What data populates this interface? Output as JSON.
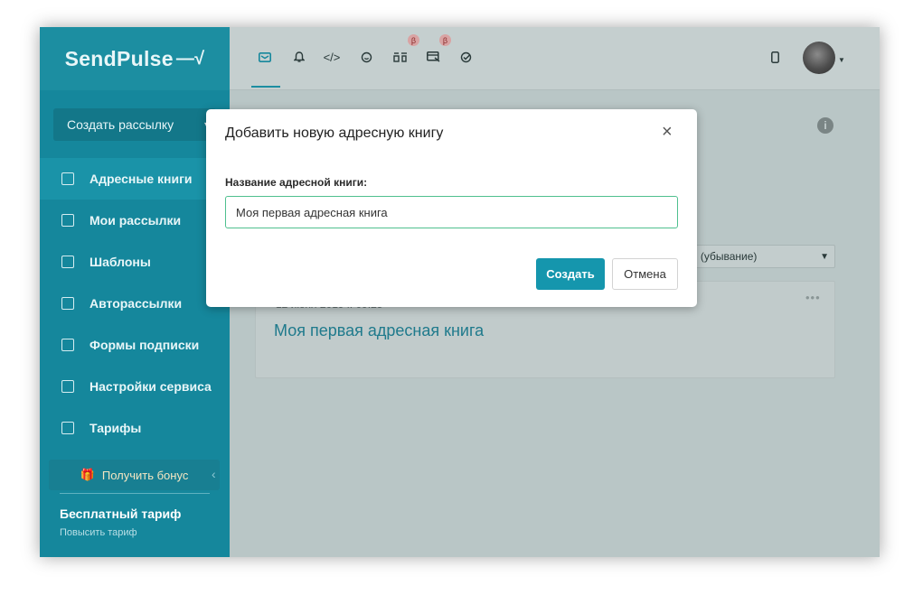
{
  "app": {
    "logo_text": "SendPulse",
    "logo_mark": "—√"
  },
  "sidebar": {
    "create_button": "Создать рассылку",
    "items": [
      {
        "label": "Адресные книги",
        "icon": "address-book-icon"
      },
      {
        "label": "Мои рассылки",
        "icon": "mailings-icon"
      },
      {
        "label": "Шаблоны",
        "icon": "templates-icon"
      },
      {
        "label": "Авторассылки",
        "icon": "automation-icon"
      },
      {
        "label": "Формы подписки",
        "icon": "subscription-forms-icon"
      },
      {
        "label": "Настройки сервиса",
        "icon": "settings-icon"
      },
      {
        "label": "Тарифы",
        "icon": "pricing-icon"
      }
    ],
    "bonus_button": "Получить бонус",
    "plan_title": "Бесплатный тариф",
    "plan_upgrade": "Повысить тариф"
  },
  "topbar": {
    "icons": [
      "email-icon",
      "push-bell-icon",
      "code-smtp-icon",
      "chat-icon",
      "chatbots-icon",
      "crm-icon",
      "check-icon"
    ],
    "beta_label": "β",
    "active_color": "#15879c"
  },
  "content": {
    "sort_option": "я (убывание)",
    "card": {
      "date": "12 июня 2019 г. 09:25",
      "title": "Моя первая адресная книга",
      "more": "•••"
    }
  },
  "modal": {
    "title": "Добавить новую адресную книгу",
    "field_label": "Название адресной книги:",
    "field_value": "Моя первая адресная книга",
    "create_button": "Создать",
    "cancel_button": "Отмена"
  },
  "colors": {
    "sidebar": "#15879c",
    "primary_button": "#1596ad",
    "input_focus": "#4fc08f"
  }
}
